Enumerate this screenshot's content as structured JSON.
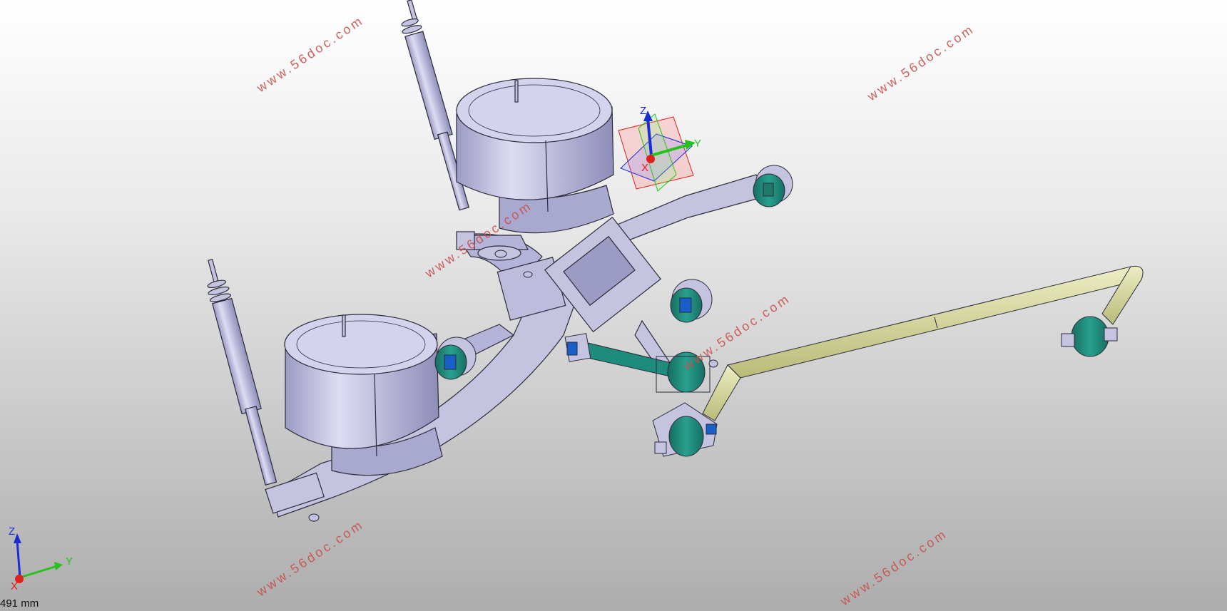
{
  "watermark": "www.56doc.com",
  "axis_labels": {
    "x": "X",
    "y": "Y",
    "z": "Z"
  },
  "scale_label": "491 mm",
  "colors": {
    "part_body": "#c4c3e0",
    "part_edge": "#2b2b3a",
    "bushing": "#1e8c7c",
    "bushing_core": "#1a5fc8",
    "stabilizer_bar": "#d7d99a",
    "axis_x": "#e0201a",
    "axis_y": "#26c21c",
    "axis_z": "#1a2cd6",
    "watermark": "#c8504c"
  },
  "icons": [
    "triad-icon",
    "manipulator-icon"
  ]
}
